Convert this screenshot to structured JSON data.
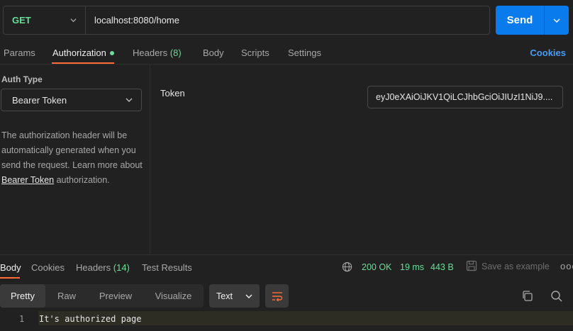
{
  "request": {
    "method": "GET",
    "url": "localhost:8080/home",
    "send_label": "Send"
  },
  "request_tabs": {
    "params": "Params",
    "authorization": "Authorization",
    "headers": "Headers",
    "headers_count": "(8)",
    "body": "Body",
    "scripts": "Scripts",
    "settings": "Settings",
    "cookies": "Cookies"
  },
  "auth": {
    "type_label": "Auth Type",
    "type_value": "Bearer Token",
    "desc_part1": "The authorization header will be automatically generated when you send the request. Learn more about ",
    "desc_link": "Bearer Token",
    "desc_part2": " authorization.",
    "token_label": "Token",
    "token_value": "eyJ0eXAiOiJKV1QiLCJhbGciOiJIUzI1NiJ9...."
  },
  "response_tabs": {
    "body": "Body",
    "cookies": "Cookies",
    "headers": "Headers",
    "headers_count": "(14)",
    "test_results": "Test Results"
  },
  "response_meta": {
    "status": "200 OK",
    "time": "19 ms",
    "size": "443 B",
    "save_example": "Save as example",
    "more": "ooo"
  },
  "format_bar": {
    "pretty": "Pretty",
    "raw": "Raw",
    "preview": "Preview",
    "visualize": "Visualize",
    "language": "Text"
  },
  "response_body": {
    "lines": [
      {
        "number": "1",
        "text": "It's authorized page"
      }
    ]
  },
  "colors": {
    "background": "#212121",
    "accent_orange": "#ff6c37",
    "send_blue": "#097bed",
    "success_green": "#6bdd9a",
    "link_blue": "#4a9cf5"
  },
  "icons": [
    "chevron-down-icon",
    "globe-icon",
    "save-icon",
    "wrap-lines-icon",
    "copy-icon",
    "search-icon"
  ]
}
